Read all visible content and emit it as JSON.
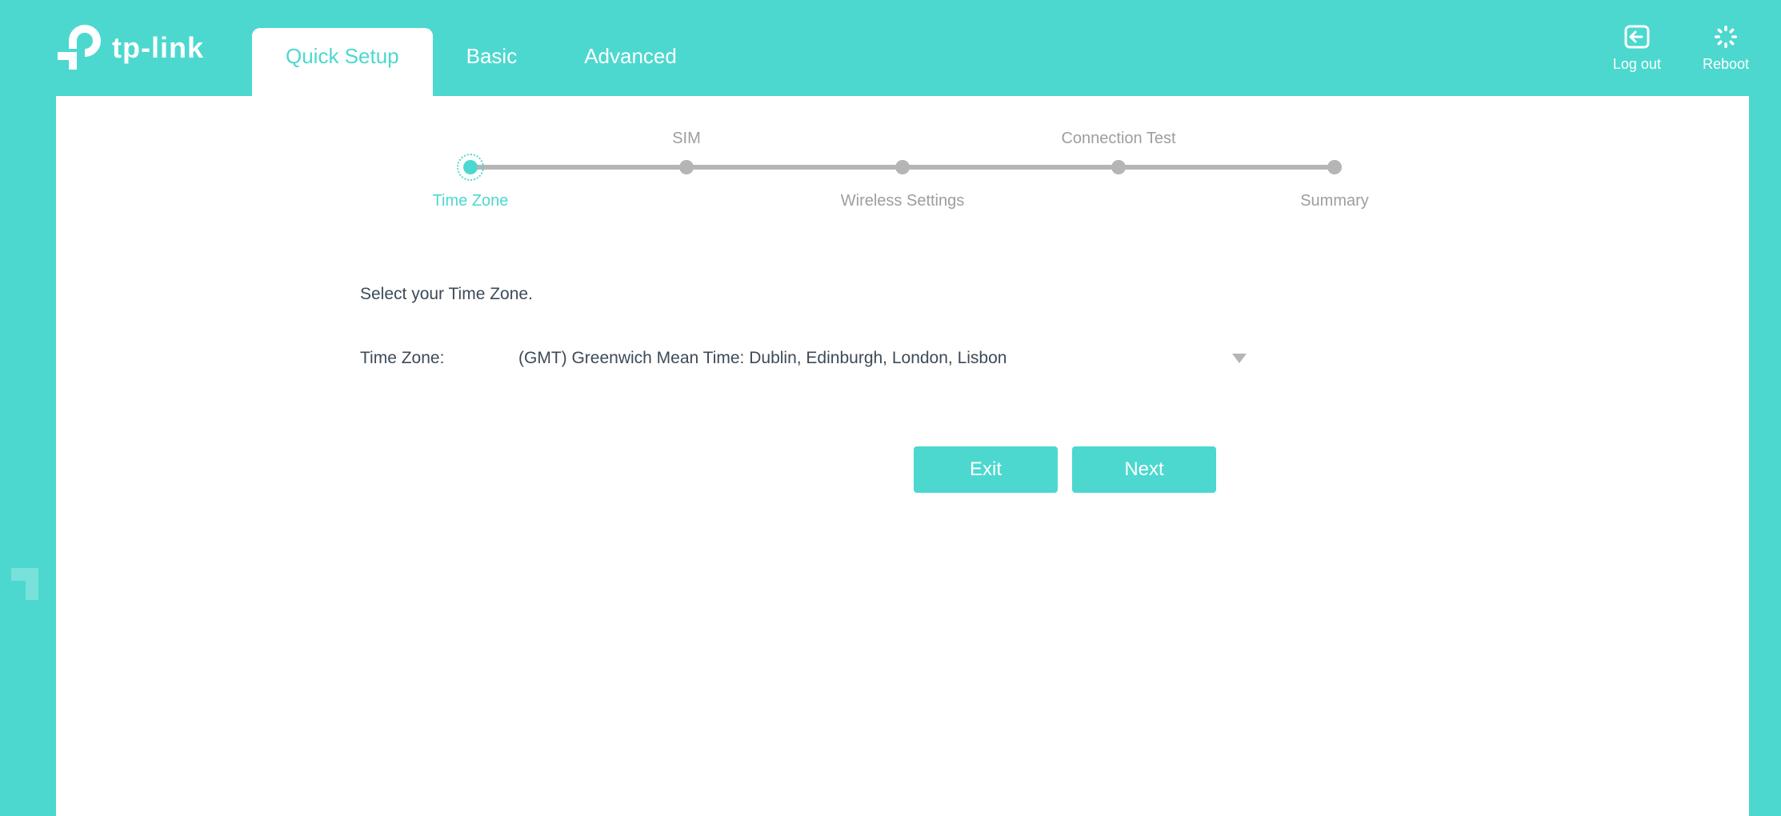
{
  "brand": {
    "name": "tp-link"
  },
  "nav": {
    "tabs": [
      {
        "label": "Quick Setup",
        "active": true
      },
      {
        "label": "Basic",
        "active": false
      },
      {
        "label": "Advanced",
        "active": false
      }
    ]
  },
  "topActions": {
    "logout": "Log out",
    "reboot": "Reboot"
  },
  "stepper": {
    "steps": [
      {
        "label": "Time Zone",
        "position": "bottom",
        "current": true
      },
      {
        "label": "SIM",
        "position": "top",
        "current": false
      },
      {
        "label": "Wireless Settings",
        "position": "bottom",
        "current": false
      },
      {
        "label": "Connection Test",
        "position": "top",
        "current": false
      },
      {
        "label": "Summary",
        "position": "bottom",
        "current": false
      }
    ]
  },
  "form": {
    "prompt": "Select your Time Zone.",
    "label": "Time Zone:",
    "selected": "(GMT) Greenwich Mean Time: Dublin, Edinburgh, London, Lisbon"
  },
  "buttons": {
    "exit": "Exit",
    "next": "Next"
  },
  "colors": {
    "accent": "#4cd8cf",
    "muted": "#b5b5b5",
    "text": "#3d4a57"
  }
}
